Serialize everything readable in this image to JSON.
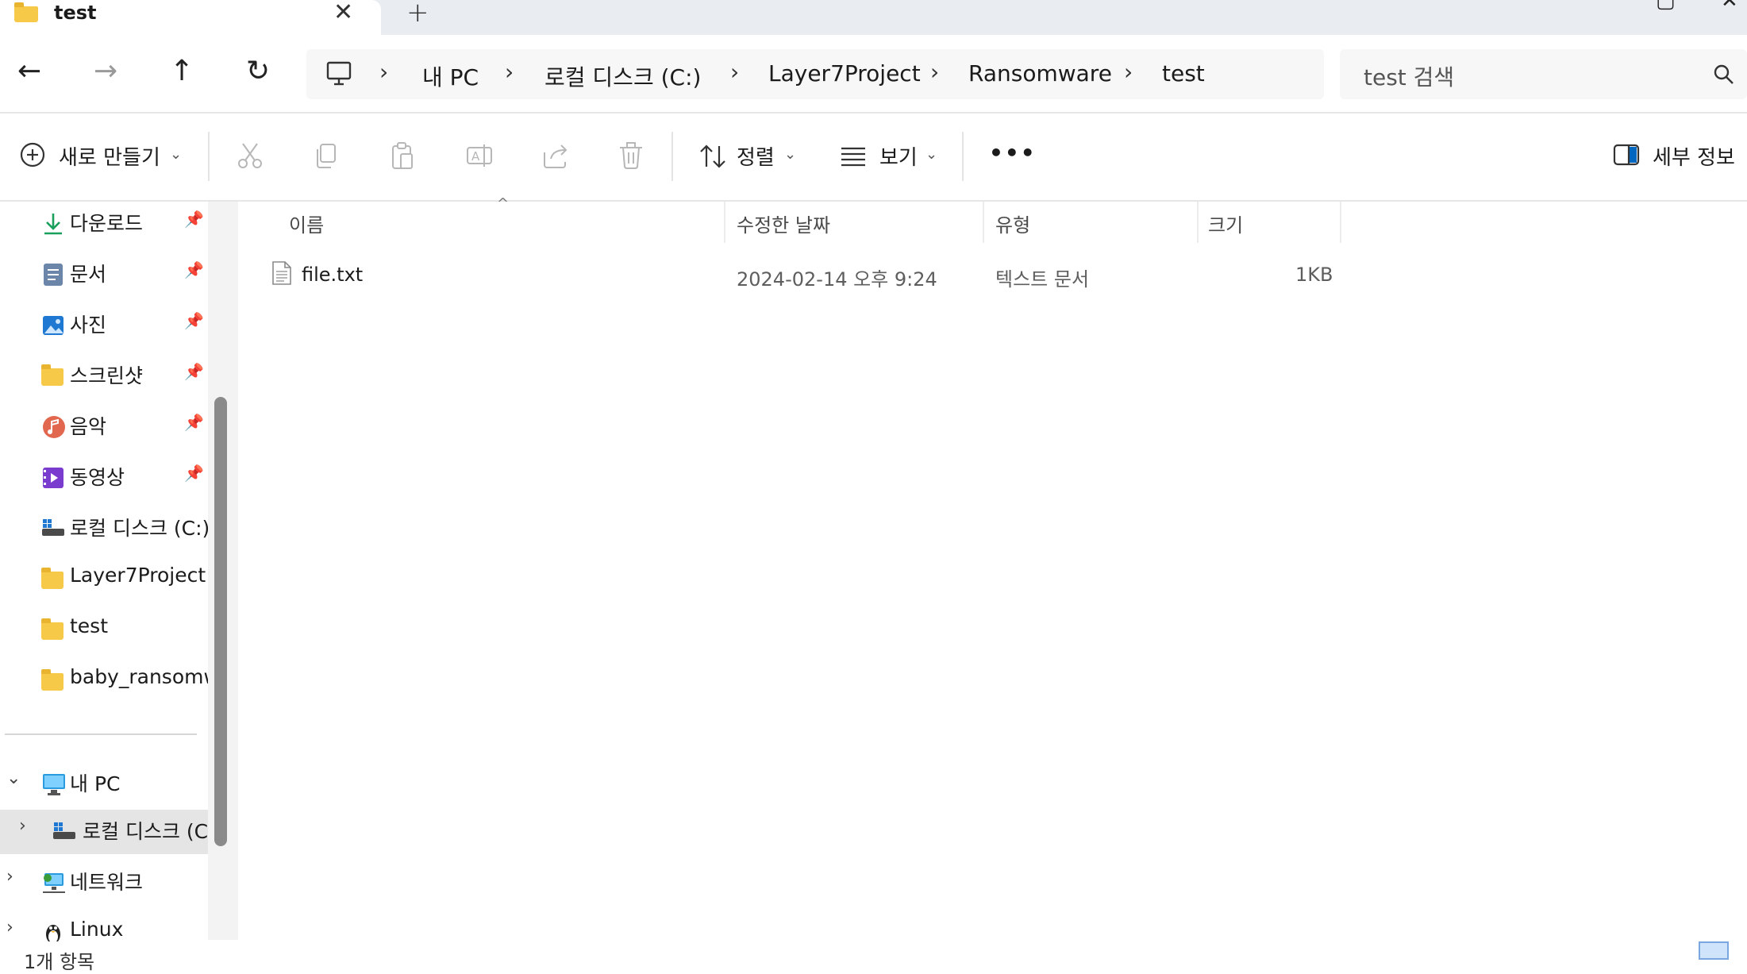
{
  "tab": {
    "title": "test",
    "close": "✕",
    "new": "+"
  },
  "nav": {
    "back": "←",
    "forward": "→",
    "up": "↑",
    "refresh": "↻"
  },
  "breadcrumb": [
    "내 PC",
    "로컬 디스크 (C:)",
    "Layer7Project",
    "Ransomware",
    "test"
  ],
  "search": {
    "placeholder": "test 검색"
  },
  "toolbar": {
    "new_label": "새로 만들기",
    "sort_label": "정렬",
    "view_label": "보기",
    "more_label": "•••",
    "details_label": "세부 정보"
  },
  "sidebar": {
    "quick": [
      {
        "label": "다운로드",
        "icon": "download-icon"
      },
      {
        "label": "문서",
        "icon": "documents-icon"
      },
      {
        "label": "사진",
        "icon": "pictures-icon"
      },
      {
        "label": "스크린샷",
        "icon": "folder-icon"
      },
      {
        "label": "음악",
        "icon": "music-icon"
      },
      {
        "label": "동영상",
        "icon": "videos-icon"
      },
      {
        "label": "로컬 디스크 (C:)",
        "icon": "drive-icon"
      },
      {
        "label": "Layer7Project",
        "icon": "folder-icon"
      },
      {
        "label": "test",
        "icon": "folder-icon"
      },
      {
        "label": "baby_ransomwa",
        "icon": "folder-icon"
      }
    ],
    "tree": [
      {
        "label": "내 PC",
        "icon": "pc-icon"
      },
      {
        "label": "로컬 디스크 (C",
        "icon": "drive-icon"
      },
      {
        "label": "네트워크",
        "icon": "network-icon"
      },
      {
        "label": "Linux",
        "icon": "linux-icon"
      }
    ]
  },
  "columns": {
    "name": "이름",
    "modified": "수정한 날짜",
    "type": "유형",
    "size": "크기"
  },
  "files": [
    {
      "name": "file.txt",
      "modified": "2024-02-14 오후 9:24",
      "type": "텍스트 문서",
      "size": "1KB"
    }
  ],
  "status": {
    "text": "1개 항목"
  },
  "colors": {
    "folder": "#f7c948",
    "accent": "#0067c0",
    "selected": "#e5e5e5"
  }
}
